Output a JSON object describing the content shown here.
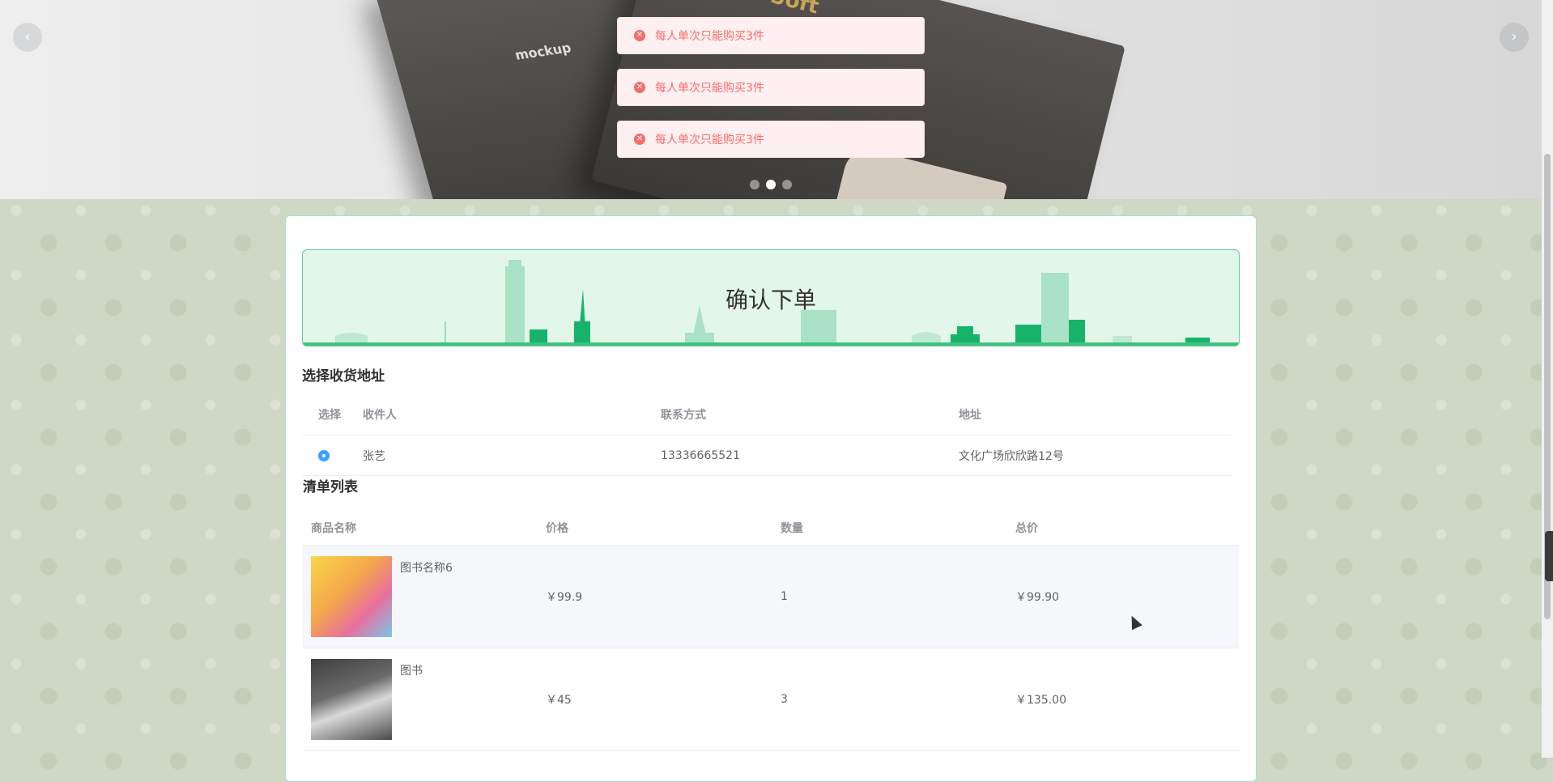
{
  "banner": {
    "prev_label": "‹",
    "next_label": "›",
    "book_text_1": "mockup",
    "book_text_2": "Soft",
    "dots": [
      false,
      true,
      false
    ]
  },
  "messages": [
    "每人单次只能购买3件",
    "每人单次只能购买3件",
    "每人单次只能购买3件"
  ],
  "hero": {
    "title": "确认下单"
  },
  "address": {
    "section_title": "选择收货地址",
    "headers": [
      "选择",
      "收件人",
      "联系方式",
      "地址"
    ],
    "rows": [
      {
        "recipient": "张艺",
        "phone": "13336665521",
        "address": "文化广场欣欣路12号"
      }
    ]
  },
  "list": {
    "section_title": "清单列表",
    "headers": [
      "商品名称",
      "价格",
      "数量",
      "总价"
    ],
    "rows": [
      {
        "name": "图书名称6",
        "price": "￥99.9",
        "qty": "1",
        "total": "￥99.90"
      },
      {
        "name": "图书",
        "price": "￥45",
        "qty": "3",
        "total": "￥135.00"
      }
    ]
  },
  "colors": {
    "accent": "#409eff",
    "error": "#f56c6c",
    "hero_bg": "#e3f6ea",
    "hero_border": "#66c89a"
  }
}
